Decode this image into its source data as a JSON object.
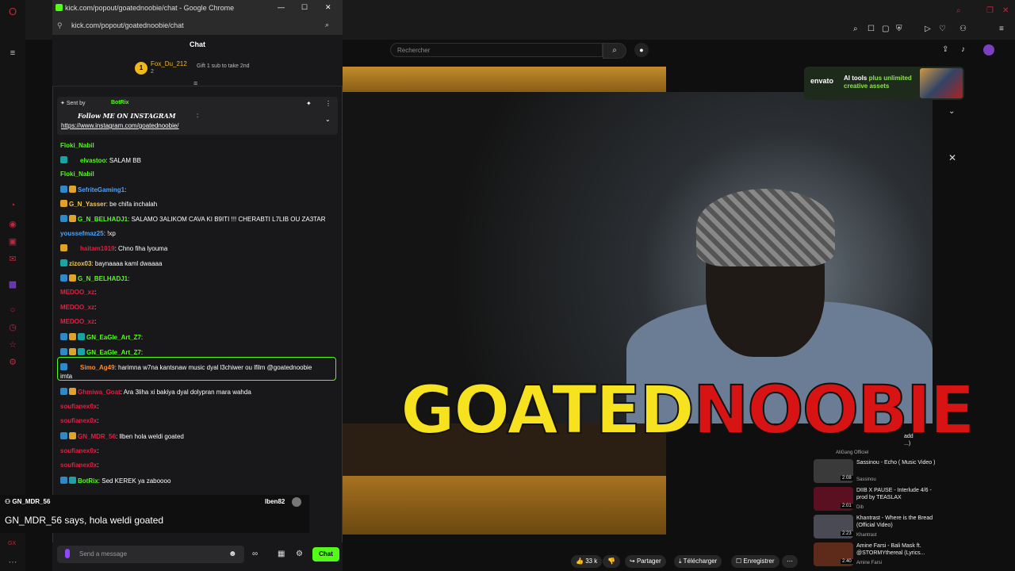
{
  "popup": {
    "window_title": "kick.com/popout/goatednoobie/chat - Google Chrome",
    "url": "kick.com/popout/goatednoobie/chat",
    "chat_header": "Chat",
    "leader": {
      "rank": "1",
      "name": "Fox_Du_212",
      "count": "2",
      "gift": "Gift 1 sub to take 2nd"
    },
    "pinned": {
      "sent_by": "Sent by",
      "author": "BotRix",
      "line1": "Follow ME ON INSTAGRAM",
      "line1b": ":",
      "link": "https://www.instagram.com/goatednoobie/"
    },
    "messages": [
      {
        "user": "Floki_Nabil",
        "text": "",
        "color": "#53fc18",
        "badges": []
      },
      {
        "user": "elvastoo",
        "text": ": SALAM BB",
        "color": "#53fc18",
        "badges": [
          "#1aa3a3"
        ]
      },
      {
        "user": "Floki_Nabil",
        "text": "",
        "color": "#53fc18",
        "badges": []
      },
      {
        "user": "SefriteGaming1",
        "text": ":",
        "color": "#4aa3ff",
        "badges": [
          "#2f88c8",
          "#e1a22a"
        ]
      },
      {
        "user": "G_N_Yasser",
        "text": ": be chifa inchalah",
        "color": "#f2c94c",
        "badges": [
          "#e1a22a"
        ]
      },
      {
        "user": "G_N_BELHADJ1",
        "text": ": SALAMO 3ALIKOM CAVA KI B9ITI !!! CHERABTI L7LIB OU ZA3TAR",
        "color": "#53fc18",
        "badges": [
          "#2f88c8",
          "#e1a22a"
        ]
      },
      {
        "user": "youssefmaz25",
        "text": ": !xp",
        "color": "#4aa3ff",
        "badges": []
      },
      {
        "user": "haitam1019",
        "text": ": Chno fiha lyouma",
        "color": "#e02040",
        "badges": [
          "#e1a22a"
        ]
      },
      {
        "user": "zizox03",
        "text": ": baynaaaa kaml dwaaaa",
        "color": "#f2c94c",
        "badges": [
          "#1aa3a3"
        ]
      },
      {
        "user": "G_N_BELHADJ1",
        "text": ":",
        "color": "#53fc18",
        "badges": [
          "#2f88c8",
          "#e1a22a"
        ]
      },
      {
        "user": "MEDOO_xz",
        "text": ":",
        "color": "#e02040",
        "badges": []
      },
      {
        "user": "MEDOO_xz",
        "text": ":",
        "color": "#e02040",
        "badges": []
      },
      {
        "user": "MEDOO_xz",
        "text": ":",
        "color": "#e02040",
        "badges": []
      },
      {
        "user": "GN_EaGle_Art_Z7",
        "text": ":",
        "color": "#53fc18",
        "badges": [
          "#2f88c8",
          "#e1a22a",
          "#1aa3a3"
        ]
      },
      {
        "user": "GN_EaGle_Art_Z7",
        "text": ":",
        "color": "#53fc18",
        "badges": [
          "#2f88c8",
          "#e1a22a",
          "#1aa3a3"
        ]
      },
      {
        "user": "Simo_Ag49",
        "text": ": harimna w7na kantsnaw music dyal l3chiwer ou lfilm @goatednoobie",
        "text2": "imta",
        "color": "#ff8c2a",
        "badges": [
          "#2f88c8"
        ]
      },
      {
        "user": "Ghmiwa_Goat",
        "text": ": Ara 3liha xi bakiya dyal dolypran mara wahda",
        "color": "#e02040",
        "badges": [
          "#2f88c8",
          "#e1a22a"
        ]
      },
      {
        "user": "soufianex0x",
        "text": ":",
        "color": "#e02040",
        "badges": []
      },
      {
        "user": "soufianex0x",
        "text": ":",
        "color": "#e02040",
        "badges": []
      },
      {
        "user": "GN_MDR_56",
        "text": ": llben hola weldi goated",
        "color": "#e02040",
        "badges": [
          "#2f88c8",
          "#e1a22a"
        ]
      },
      {
        "user": "soufianex0x",
        "text": ":",
        "color": "#e02040",
        "badges": []
      },
      {
        "user": "soufianex0x",
        "text": ":",
        "color": "#e02040",
        "badges": []
      },
      {
        "user": "BotRix",
        "text": ": Sed KEREK ya zaboooo",
        "color": "#53fc18",
        "badges": [
          "#2f88c8",
          "#1aa3a3"
        ]
      }
    ],
    "reply": {
      "user": "GN_MDR_56",
      "right_user": "lben82",
      "text": "GN_MDR_56 says, hola weldi goated"
    },
    "input_placeholder": "Send a message",
    "chat_button": "Chat"
  },
  "youtube": {
    "search_placeholder": "Rechercher",
    "ad": {
      "brand": "envato",
      "text_a": "AI tools",
      "text_b": "plus",
      "text_c": "unlimited creative assets"
    },
    "logo_a": "GOATED",
    "logo_b": "NOOBIE",
    "recs": [
      {
        "title": "add",
        "title2": "...)",
        "channel": "AliGang Officiel",
        "dur": ""
      },
      {
        "title": "Sassinou - Echo ( Music Video )",
        "channel": "Sassinou",
        "dur": "2:08"
      },
      {
        "title": "DIIB X PAUSE - Interlude 4/6 - prod by TEASLAX",
        "channel": "Dib",
        "dur": "2:01"
      },
      {
        "title": "Khantrast - Where is the Bread (Official Video)",
        "channel": "Khantrast",
        "dur": "2:23"
      },
      {
        "title": "Amine Farsi - Bali Mask ft. @STORMYthereal (Lyrics...",
        "channel": "Amine Farsi",
        "dur": "2:40"
      }
    ],
    "actions": {
      "likes": "33 k",
      "share": "Partager",
      "download": "Télécharger",
      "save": "Enregistrer"
    }
  },
  "colors": {
    "kick_green": "#53fc18",
    "opera_red": "#c0283a"
  }
}
